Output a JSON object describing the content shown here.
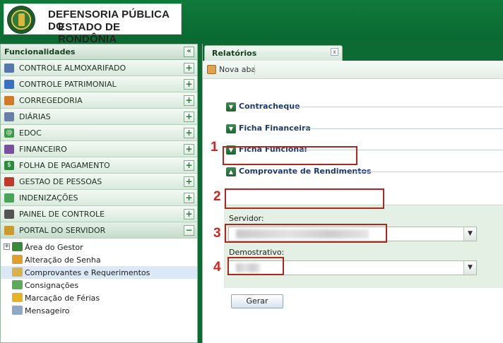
{
  "header": {
    "org_line1": "DEFENSORIA PÚBLICA DO",
    "org_line2": "ESTADO DE RONDÔNIA"
  },
  "sidebar": {
    "title": "Funcionalidades",
    "collapse_icon": "«",
    "items": [
      {
        "label": "CONTROLE ALMOXARIFADO",
        "icon": "warehouse-icon",
        "color": "#5577aa"
      },
      {
        "label": "CONTROLE PATRIMONIAL",
        "icon": "building-icon",
        "color": "#3b6fc4"
      },
      {
        "label": "CORREGEDORIA",
        "icon": "people-icon",
        "color": "#d07a2a"
      },
      {
        "label": "DIÁRIAS",
        "icon": "ticket-icon",
        "color": "#6a7fa8"
      },
      {
        "label": "EDOC",
        "icon": "at-icon",
        "color": "#3c9a4a"
      },
      {
        "label": "FINANCEIRO",
        "icon": "chart-icon",
        "color": "#7a4fa0"
      },
      {
        "label": "FOLHA DE PAGAMENTO",
        "icon": "dollar-icon",
        "color": "#2d8a3e"
      },
      {
        "label": "GESTAO DE PESSOAS",
        "icon": "calendar-icon",
        "color": "#c0392b"
      },
      {
        "label": "INDENIZAÇÕES",
        "icon": "money-icon",
        "color": "#4aa35a"
      },
      {
        "label": "PAINEL DE CONTROLE",
        "icon": "panel-icon",
        "color": "#555555"
      },
      {
        "label": "PORTAL DO SERVIDOR",
        "icon": "portal-icon",
        "color": "#c99a2e"
      }
    ],
    "plus_symbol": "+",
    "minus_symbol": "−",
    "tree": [
      {
        "label": "Área do Gestor",
        "icon": "people-icon",
        "color": "#3a8a3a"
      },
      {
        "label": "Alteração de Senha",
        "icon": "key-icon",
        "color": "#e0a030"
      },
      {
        "label": "Comprovantes e Requerimentos",
        "icon": "grid-icon",
        "color": "#d8b24a"
      },
      {
        "label": "Consignações",
        "icon": "money-icon",
        "color": "#5aab5a"
      },
      {
        "label": "Marcação de Férias",
        "icon": "bus-icon",
        "color": "#e6b422"
      },
      {
        "label": "Mensageiro",
        "icon": "chat-icon",
        "color": "#8fa8c8"
      }
    ]
  },
  "tabs": {
    "active": "Relatórios",
    "close": "x"
  },
  "toolbar": {
    "new_tab": "Nova aba"
  },
  "report": {
    "sections": [
      {
        "label": "Contracheque"
      },
      {
        "label": "Ficha Financeira"
      },
      {
        "label": "Ficha Funcional"
      },
      {
        "label": "Comprovante de Rendimentos"
      }
    ],
    "servidor_label": "Servidor:",
    "servidor_value": "",
    "demonstrativo_label": "Demostrativo:",
    "demonstrativo_value": "",
    "gerar_label": "Gerar"
  },
  "annotations": [
    "1",
    "2",
    "3",
    "4"
  ],
  "colors": {
    "brand_green": "#0b6b32",
    "highlight_red": "#b0251c"
  }
}
